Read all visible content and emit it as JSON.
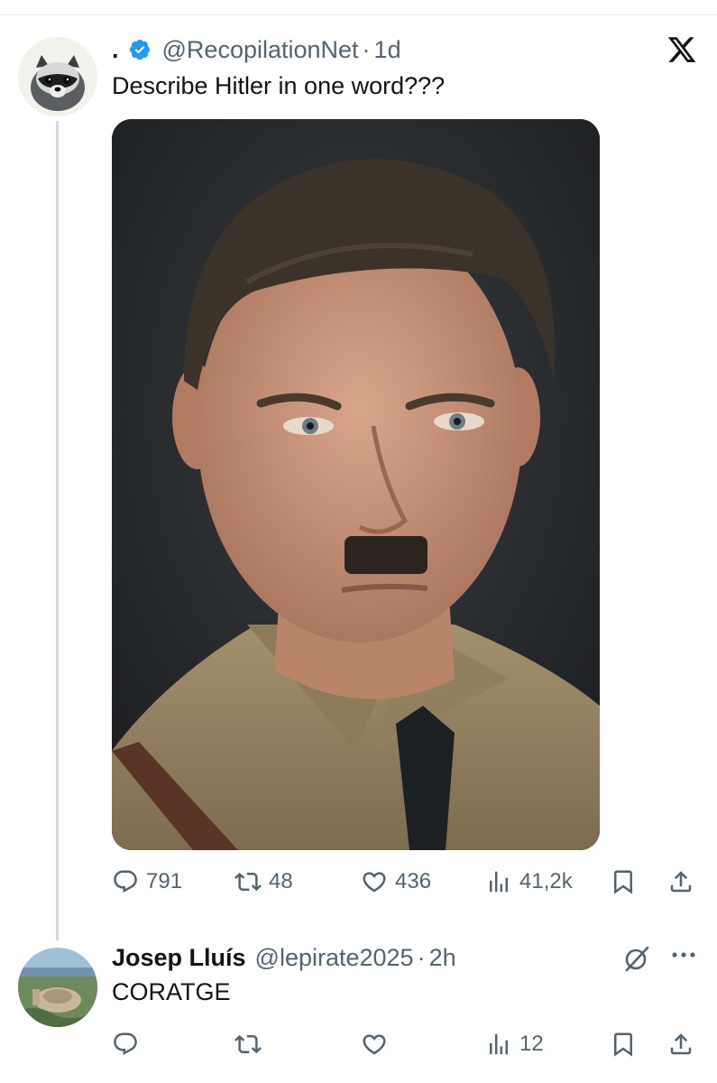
{
  "post": {
    "display_name": ".",
    "handle": "@RecopilationNet",
    "separator": "·",
    "time": "1d",
    "text": "Describe Hitler in one word???",
    "verified_color": "#1d9bf0",
    "stats": {
      "replies": "791",
      "reposts": "48",
      "likes": "436",
      "views": "41,2k"
    }
  },
  "reply": {
    "display_name": "Josep Lluís",
    "handle": "@lepirate2025",
    "separator": "·",
    "time": "2h",
    "text": "CORATGE",
    "stats": {
      "views": "12"
    }
  },
  "icons": {
    "close": "x-logo-icon",
    "reply": "reply-icon",
    "repost": "repost-icon",
    "like": "heart-icon",
    "views": "views-icon",
    "bookmark": "bookmark-icon",
    "share": "share-icon",
    "grok": "grok-icon",
    "more": "more-icon"
  },
  "colors": {
    "text": "#0f1419",
    "secondary": "#536471",
    "thread_line": "#cfd9de"
  }
}
